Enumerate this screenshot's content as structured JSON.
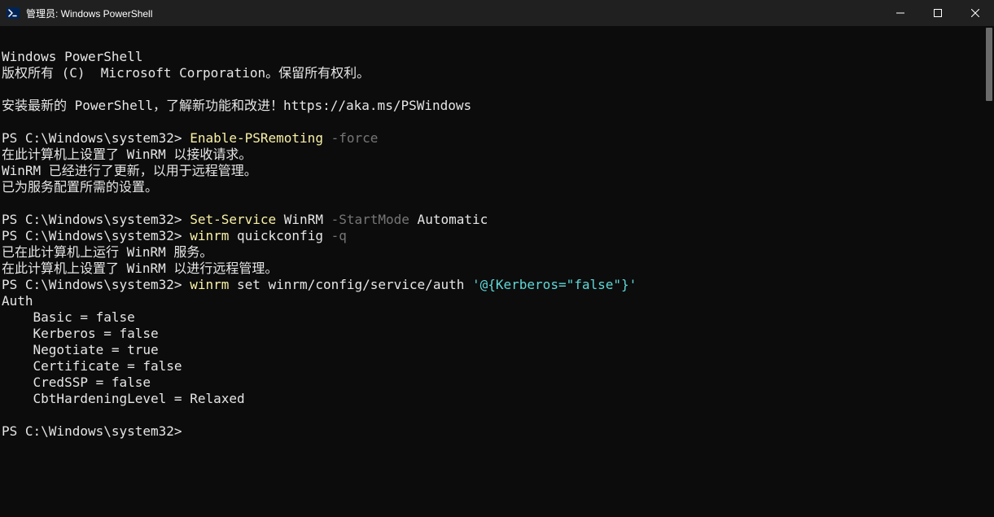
{
  "window": {
    "title": "管理员: Windows PowerShell"
  },
  "lines": {
    "l1": "Windows PowerShell",
    "l2": "版权所有 (C)  Microsoft Corporation。保留所有权利。",
    "l3": "",
    "l4": "安装最新的 PowerShell，了解新功能和改进！https://aka.ms/PSWindows",
    "l5": "",
    "prompt1": "PS C:\\Windows\\system32> ",
    "cmd1a": "Enable-PSRemoting",
    "cmd1b": " -force",
    "l7": "在此计算机上设置了 WinRM 以接收请求。",
    "l8": "WinRM 已经进行了更新，以用于远程管理。",
    "l9": "已为服务配置所需的设置。",
    "l10": "",
    "prompt2": "PS C:\\Windows\\system32> ",
    "cmd2a": "Set-Service",
    "cmd2b": " WinRM ",
    "cmd2c": "-StartMode",
    "cmd2d": " Automatic",
    "prompt3": "PS C:\\Windows\\system32> ",
    "cmd3a": "winrm",
    "cmd3b": " quickconfig ",
    "cmd3c": "-q",
    "l13": "已在此计算机上运行 WinRM 服务。",
    "l14": "在此计算机上设置了 WinRM 以进行远程管理。",
    "prompt4": "PS C:\\Windows\\system32> ",
    "cmd4a": "winrm",
    "cmd4b": " set winrm/config/service/auth ",
    "cmd4c": "'@{Kerberos=\"false\"}'",
    "l16": "Auth",
    "l17": "    Basic = false",
    "l18": "    Kerberos = false",
    "l19": "    Negotiate = true",
    "l20": "    Certificate = false",
    "l21": "    CredSSP = false",
    "l22": "    CbtHardeningLevel = Relaxed",
    "l23": "",
    "prompt5": "PS C:\\Windows\\system32>"
  }
}
